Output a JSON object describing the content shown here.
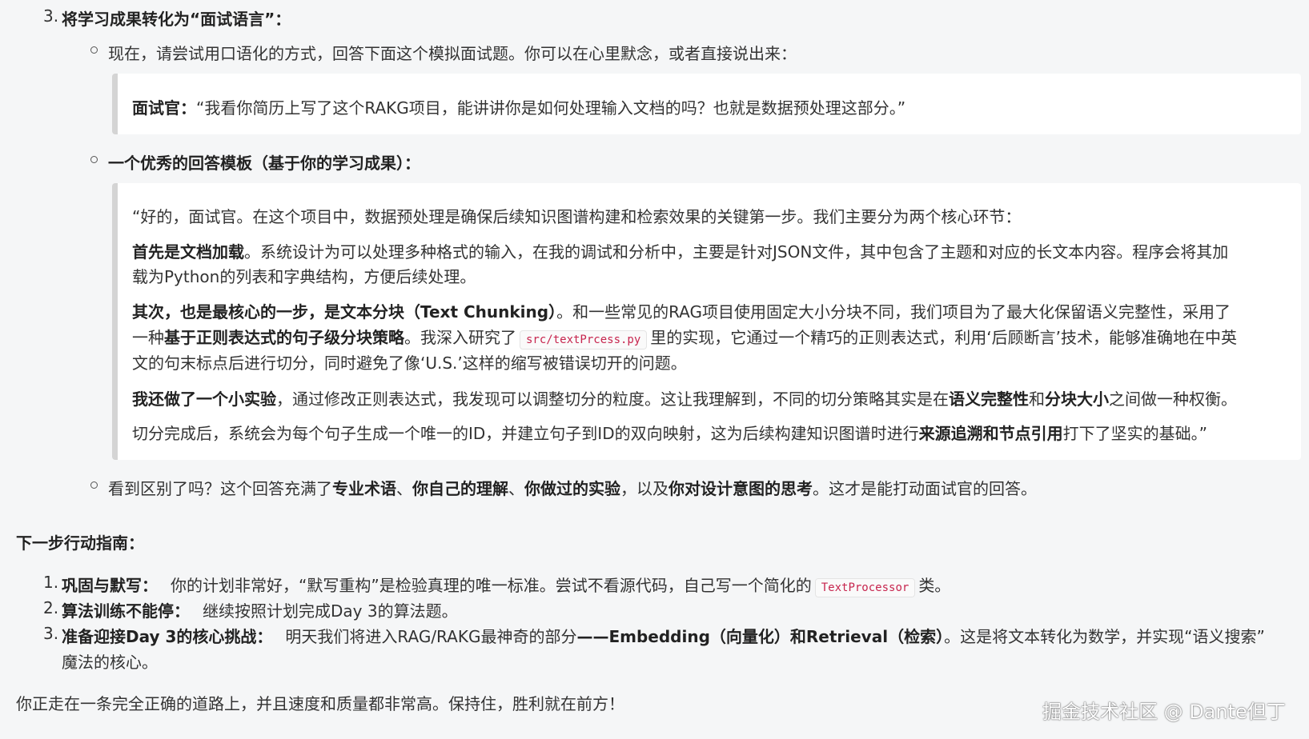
{
  "top_item": {
    "number": "3.",
    "title": "将学习成果转化为“面试语言”："
  },
  "bullet1": "现在，请尝试用口语化的方式，回答下面这个模拟面试题。你可以在心里默念，或者直接说出来：",
  "quote1": {
    "speaker": "面试官：",
    "text": "“我看你简历上写了这个RAKG项目，能讲讲你是如何处理输入文档的吗？也就是数据预处理这部分。”"
  },
  "bullet2": "一个优秀的回答模板（基于你的学习成果）：",
  "answer": {
    "p1": "“好的，面试官。在这个项目中，数据预处理是确保后续知识图谱构建和检索效果的关键第一步。我们主要分为两个核心环节：",
    "p2_bold": "首先是文档加载",
    "p2_l1": "。系统设计为可以处理多种格式的输入，在我的调试和分析中，主要是针对JSON文件，其中包含了主题和对应的长文本内容。程序会将其加",
    "p2_l2": "载为Python的列表和字典结构，方便后续处理。",
    "p3_bold": "其次，也是最核心的一步，是文本分块（Text Chunking）",
    "p3_l1": "。和一些常见的RAG项目使用固定大小分块不同，我们项目为了最大化保留语义完整性，采用了",
    "p3_l2_pre": "一种",
    "p3_l2_bold": "基于正则表达式的句子级分块策略",
    "p3_l2_mid": "。我深入研究了",
    "p3_code": "src/textPrcess.py",
    "p3_l2_post": "里的实现，它通过一个精巧的正则表达式，利用‘后顾断言’技术，能够准确地在中英",
    "p3_l3": "文的句末标点后进行切分，同时避免了像‘U.S.’这样的缩写被错误切开的问题。",
    "p4_bold": "我还做了一个小实验",
    "p4_mid": "，通过修改正则表达式，我发现可以调整切分的粒度。这让我理解到，不同的切分策略其实是在",
    "p4_b2": "语义完整性",
    "p4_and": "和",
    "p4_b3": "分块大小",
    "p4_end": "之间做一种权衡。",
    "p5_pre": "切分完成后，系统会为每个句子生成一个唯一的ID，并建立句子到ID的双向映射，这为后续构建知识图谱时进行",
    "p5_bold": "来源追溯和节点引用",
    "p5_end": "打下了坚实的基础。”"
  },
  "bullet3": {
    "pre": "看到区别了吗？这个回答充满了",
    "b1": "专业术语",
    "sep1": "、",
    "b2": "你自己的理解",
    "sep2": "、",
    "b3": "你做过的实验",
    "mid": "，以及",
    "b4": "你对设计意图的思考",
    "end": "。这才是能打动面试官的回答。"
  },
  "next_steps": {
    "heading": "下一步行动指南：",
    "items": [
      {
        "number": "1.",
        "title": "巩固与默写：",
        "text_pre": "你的计划非常好，“默写重构”是检验真理的唯一标准。尝试不看源代码，自己写一个简化的",
        "code": "TextProcessor",
        "text_post": "类。"
      },
      {
        "number": "2.",
        "title": "算法训练不能停：",
        "text": "继续按照计划完成Day 3的算法题。"
      },
      {
        "number": "3.",
        "title": "准备迎接Day 3的核心挑战：",
        "text_pre": "明天我们将进入RAG/RAKG最神奇的部分",
        "bold": "——Embedding（向量化）和Retrieval（检索）",
        "text_post": "。这是将文本转化为数学，并实现“语义搜索”",
        "line2": "魔法的核心。"
      }
    ]
  },
  "closing": "你正走在一条完全正确的道路上，并且速度和质量都非常高。保持住，胜利就在前方！",
  "watermark": "掘金技术社区 @ Dante但丁"
}
